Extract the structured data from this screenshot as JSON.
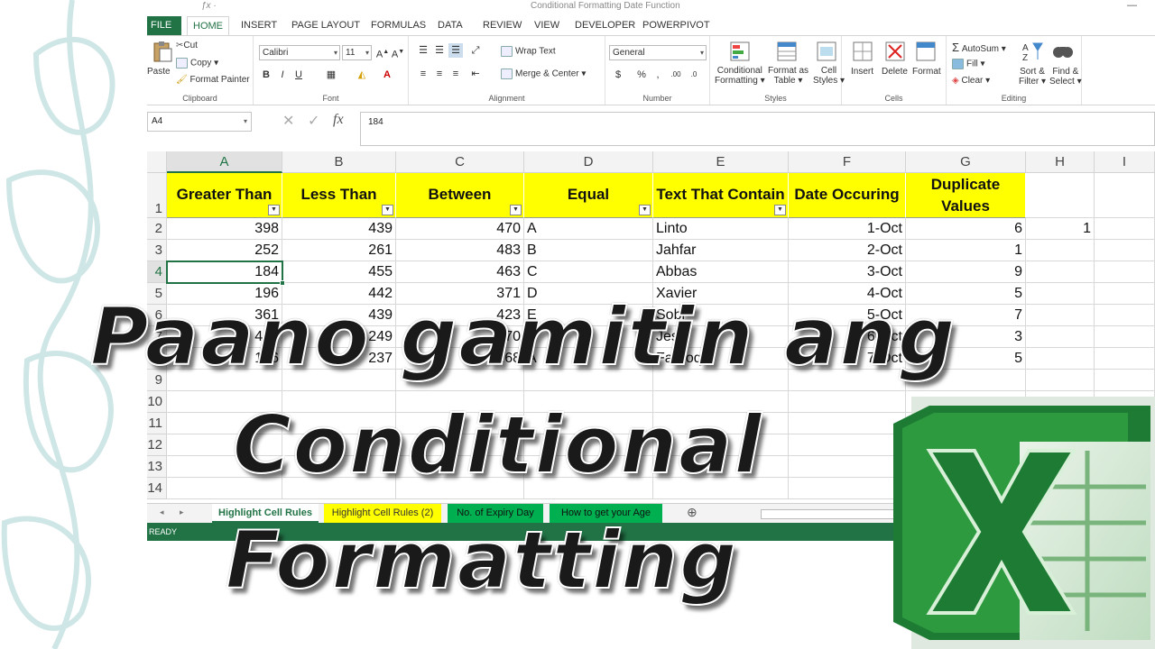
{
  "window": {
    "title": "Conditional Formatting Date Function"
  },
  "ribbon_tabs": [
    "FILE",
    "HOME",
    "INSERT",
    "PAGE LAYOUT",
    "FORMULAS",
    "DATA",
    "REVIEW",
    "VIEW",
    "DEVELOPER",
    "POWERPIVOT"
  ],
  "ribbon": {
    "clipboard": {
      "paste": "Paste",
      "cut": "Cut",
      "copy": "Copy",
      "format_painter": "Format Painter",
      "label": "Clipboard"
    },
    "font": {
      "name": "Calibri",
      "size": "11",
      "label": "Font"
    },
    "alignment": {
      "wrap": "Wrap Text",
      "merge": "Merge & Center",
      "label": "Alignment"
    },
    "number": {
      "format": "General",
      "label": "Number"
    },
    "styles": {
      "cond1": "Conditional",
      "cond2": "Formatting",
      "table1": "Format as",
      "table2": "Table",
      "cell1": "Cell",
      "cell2": "Styles",
      "label": "Styles"
    },
    "cells": {
      "insert": "Insert",
      "delete": "Delete",
      "format": "Format",
      "label": "Cells"
    },
    "editing": {
      "autosum": "AutoSum",
      "fill": "Fill",
      "clear": "Clear",
      "sort1": "Sort &",
      "sort2": "Filter",
      "find1": "Find &",
      "find2": "Select",
      "label": "Editing"
    }
  },
  "formula_bar": {
    "name_box": "A4",
    "fx": "fx",
    "value": "184"
  },
  "columns": [
    "A",
    "B",
    "C",
    "D",
    "E",
    "F",
    "G",
    "H",
    "I"
  ],
  "rows": [
    "1",
    "2",
    "3",
    "4",
    "5",
    "6",
    "7",
    "8",
    "9",
    "10",
    "11",
    "12",
    "13",
    "14"
  ],
  "headers": {
    "a": "Greater Than",
    "b": "Less Than",
    "c": "Between",
    "d": "Equal",
    "e": "Text That Contain",
    "f": "Date Occuring",
    "g1": "Duplicate",
    "g2": "Values"
  },
  "data_rows": [
    {
      "a": "398",
      "b": "439",
      "c": "470",
      "d": "A",
      "e": "Linto",
      "f": "1-Oct",
      "g": "6",
      "h": "1"
    },
    {
      "a": "252",
      "b": "261",
      "c": "483",
      "d": "B",
      "e": "Jahfar",
      "f": "2-Oct",
      "g": "1",
      "h": ""
    },
    {
      "a": "184",
      "b": "455",
      "c": "463",
      "d": "C",
      "e": "Abbas",
      "f": "3-Oct",
      "g": "9",
      "h": ""
    },
    {
      "a": "196",
      "b": "442",
      "c": "371",
      "d": "D",
      "e": "Xavier",
      "f": "4-Oct",
      "g": "5",
      "h": ""
    },
    {
      "a": "361",
      "b": "439",
      "c": "423",
      "d": "E",
      "e": "Sobi",
      "f": "5-Oct",
      "g": "7",
      "h": ""
    },
    {
      "a": "413",
      "b": "249",
      "c": "170",
      "d": "F",
      "e": "Jessi",
      "f": "6-Oct",
      "g": "3",
      "h": ""
    },
    {
      "a": "156",
      "b": "237",
      "c": "268",
      "d": "A",
      "e": "Farooq",
      "f": "7-Oct",
      "g": "5",
      "h": ""
    }
  ],
  "sheet_tabs": [
    "Highlight Cell Rules",
    "Highlight Cell Rules (2)",
    "No. of Expiry Day",
    "How to get your Age"
  ],
  "status": {
    "text": "READY"
  },
  "headline": {
    "line1": "Paano gamitin ang",
    "line2": "Conditional",
    "line3": "Formatting"
  },
  "colors": {
    "excel_green": "#217346",
    "header_yellow": "#ffff00",
    "tab_green": "#00b050"
  },
  "icons": [
    "paste-icon",
    "cut-icon",
    "copy-icon",
    "format-painter-icon",
    "wrap-text-icon",
    "merge-icon",
    "conditional-formatting-icon",
    "format-as-table-icon",
    "cell-styles-icon",
    "insert-icon",
    "delete-icon",
    "format-icon",
    "autosum-icon",
    "fill-icon",
    "clear-icon",
    "sort-filter-icon",
    "find-select-icon",
    "excel-logo-icon"
  ]
}
